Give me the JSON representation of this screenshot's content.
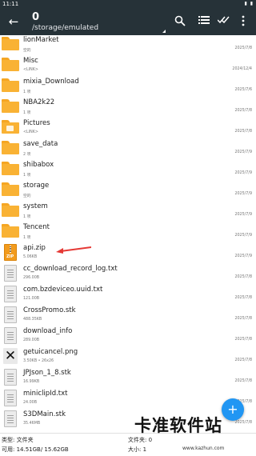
{
  "status": {
    "time": "11:11",
    "right": "▮ ▮"
  },
  "toolbar": {
    "title": "0",
    "path": "/storage/emulated",
    "icons": [
      "back-arrow-icon",
      "search-icon",
      "list-view-icon",
      "select-all-icon",
      "overflow-menu-icon"
    ]
  },
  "items": [
    {
      "type": "folder",
      "name": "lionMarket",
      "meta": "空的",
      "date": "2025/7/8"
    },
    {
      "type": "folder",
      "name": "Misc",
      "meta": "<LINK>",
      "date": "2024/12/4"
    },
    {
      "type": "folder",
      "name": "mixia_Download",
      "meta": "1 项",
      "date": "2025/7/6"
    },
    {
      "type": "folder",
      "name": "NBA2k22",
      "meta": "1 项",
      "date": "2025/7/8"
    },
    {
      "type": "folder-image",
      "name": "Pictures",
      "meta": "<LINK>",
      "date": "2025/7/8"
    },
    {
      "type": "folder",
      "name": "save_data",
      "meta": "2 项",
      "date": "2025/7/9"
    },
    {
      "type": "folder",
      "name": "shibabox",
      "meta": "1 项",
      "date": "2025/7/9"
    },
    {
      "type": "folder",
      "name": "storage",
      "meta": "空的",
      "date": "2025/7/9"
    },
    {
      "type": "folder",
      "name": "system",
      "meta": "1 项",
      "date": "2025/7/9"
    },
    {
      "type": "folder",
      "name": "Tencent",
      "meta": "1 项",
      "date": "2025/7/9"
    },
    {
      "type": "zip",
      "name": "api.zip",
      "meta": "5.06KB",
      "date": "2025/7/9"
    },
    {
      "type": "file",
      "name": "cc_download_record_log.txt",
      "meta": "296.00B",
      "date": "2025/7/8"
    },
    {
      "type": "file",
      "name": "com.bzdeviceo.uuid.txt",
      "meta": "121.00B",
      "date": "2025/7/8"
    },
    {
      "type": "file",
      "name": "CrossPromo.stk",
      "meta": "488.35KB",
      "date": "2025/7/8"
    },
    {
      "type": "file",
      "name": "download_info",
      "meta": "289.00B",
      "date": "2025/7/8"
    },
    {
      "type": "image",
      "name": "getuicancel.png",
      "meta": "3.50KB  •  26x26",
      "date": "2025/7/8"
    },
    {
      "type": "file",
      "name": "JPJson_1_8.stk",
      "meta": "16.99KB",
      "date": "2025/7/8"
    },
    {
      "type": "file",
      "name": "miniclipId.txt",
      "meta": "24.00B",
      "date": "2025/7/8"
    },
    {
      "type": "file",
      "name": "S3DMain.stk",
      "meta": "35.46MB",
      "date": "2025/7/8"
    }
  ],
  "footer": {
    "type_label": "类型: 文件夹",
    "free_label": "可用: 14.51GB/ 15.62GB",
    "count_label": "文件夹: 0",
    "size_label": "大小: 1"
  },
  "fab_label": "+",
  "watermark": {
    "title": "卡准软件站",
    "url": "www.kazhun.com"
  },
  "colors": {
    "toolbar": "#263238",
    "folder": "#f9b234",
    "fab": "#2196f3",
    "arrow": "#e53935"
  }
}
